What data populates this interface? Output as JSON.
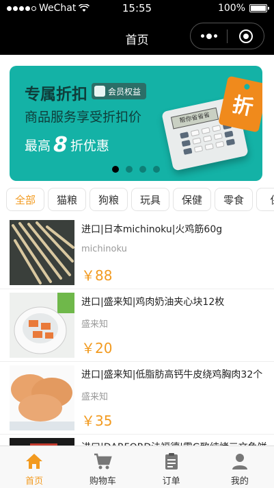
{
  "status": {
    "carrier": "WeChat",
    "time": "15:55",
    "battery": "100%"
  },
  "nav": {
    "title": "首页"
  },
  "banner": {
    "title": "专属折扣",
    "badge": "会员权益",
    "line2": "商品服务享受折扣价",
    "line3_prefix": "最高",
    "line3_number": "8",
    "line3_suffix": "折优惠",
    "calculator_screen": "帮你省省省",
    "tag_text": "折",
    "slide_count": 4,
    "active_slide": 0,
    "colors": {
      "background": "#14b2a6",
      "tag": "#f08a1c"
    }
  },
  "categories": {
    "active": "全部",
    "items": [
      "全部",
      "猫粮",
      "狗粮",
      "玩具",
      "保健",
      "零食",
      "保"
    ]
  },
  "products": [
    {
      "name": "进口|日本michinoku|火鸡筋60g",
      "brand": "michinoku",
      "price": "￥88"
    },
    {
      "name": "进口|盛来知|鸡肉奶油夹心块12枚",
      "brand": "盛来知",
      "price": "￥20"
    },
    {
      "name": "进口|盛来知|低脂肪高钙牛皮绕鸡胸肉32个",
      "brand": "盛来知",
      "price": "￥35"
    },
    {
      "name": "进口|DARFORD法福德|零G致纯烤三文鱼饼",
      "brand": "",
      "price": ""
    }
  ],
  "tabbar": {
    "items": [
      {
        "label": "首页",
        "icon": "home-icon",
        "active": true
      },
      {
        "label": "购物车",
        "icon": "cart-icon",
        "active": false
      },
      {
        "label": "订单",
        "icon": "order-icon",
        "active": false
      },
      {
        "label": "我的",
        "icon": "user-icon",
        "active": false
      }
    ],
    "accent": "#f29a1f"
  }
}
